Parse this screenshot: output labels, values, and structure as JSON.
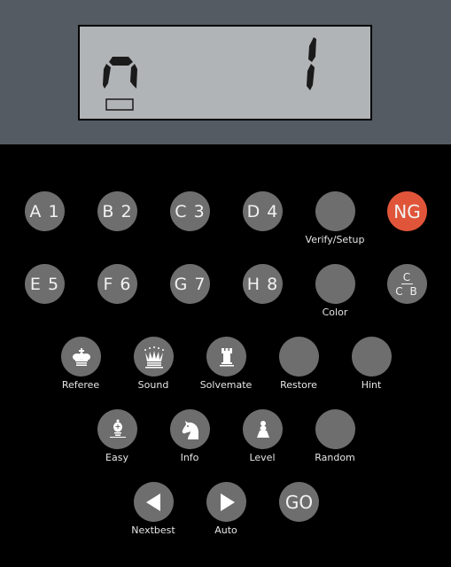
{
  "display": {
    "left_digit": "n",
    "right_digit": "1",
    "indicator": "underscore-box",
    "colors": {
      "panel": "#545b63",
      "lcd_bg": "#b1b4b6",
      "segment": "#1a1a1a"
    }
  },
  "colors": {
    "button": "#6e6e6e",
    "button_accent": "#e0553a",
    "label": "#e6e6e6",
    "background": "#000000"
  },
  "rows": {
    "row1": [
      {
        "text": "A 1",
        "label": ""
      },
      {
        "text": "B 2",
        "label": ""
      },
      {
        "text": "C 3",
        "label": ""
      },
      {
        "text": "D 4",
        "label": ""
      },
      {
        "text": "",
        "label": "Verify/Setup"
      },
      {
        "text": "NG",
        "label": "",
        "accent": true
      }
    ],
    "row2": [
      {
        "text": "E 5",
        "label": ""
      },
      {
        "text": "F 6",
        "label": ""
      },
      {
        "text": "G 7",
        "label": ""
      },
      {
        "text": "H 8",
        "label": ""
      },
      {
        "text": "",
        "label": "Color"
      },
      {
        "fraction_top": "C",
        "fraction_bottom": "CB",
        "label": ""
      }
    ],
    "row3": [
      {
        "icon": "king-icon",
        "label": "Referee"
      },
      {
        "icon": "queen-icon",
        "label": "Sound"
      },
      {
        "icon": "rook-icon",
        "label": "Solvemate"
      },
      {
        "icon": "",
        "label": "Restore"
      },
      {
        "icon": "",
        "label": "Hint"
      }
    ],
    "row4": [
      {
        "icon": "bishop-icon",
        "label": "Easy"
      },
      {
        "icon": "knight-icon",
        "label": "Info"
      },
      {
        "icon": "pawn-icon",
        "label": "Level"
      },
      {
        "icon": "",
        "label": "Random"
      }
    ],
    "row5": [
      {
        "icon": "left-arrow-icon",
        "label": "Nextbest"
      },
      {
        "icon": "right-arrow-icon",
        "label": "Auto"
      },
      {
        "text": "GO",
        "label": ""
      }
    ]
  }
}
